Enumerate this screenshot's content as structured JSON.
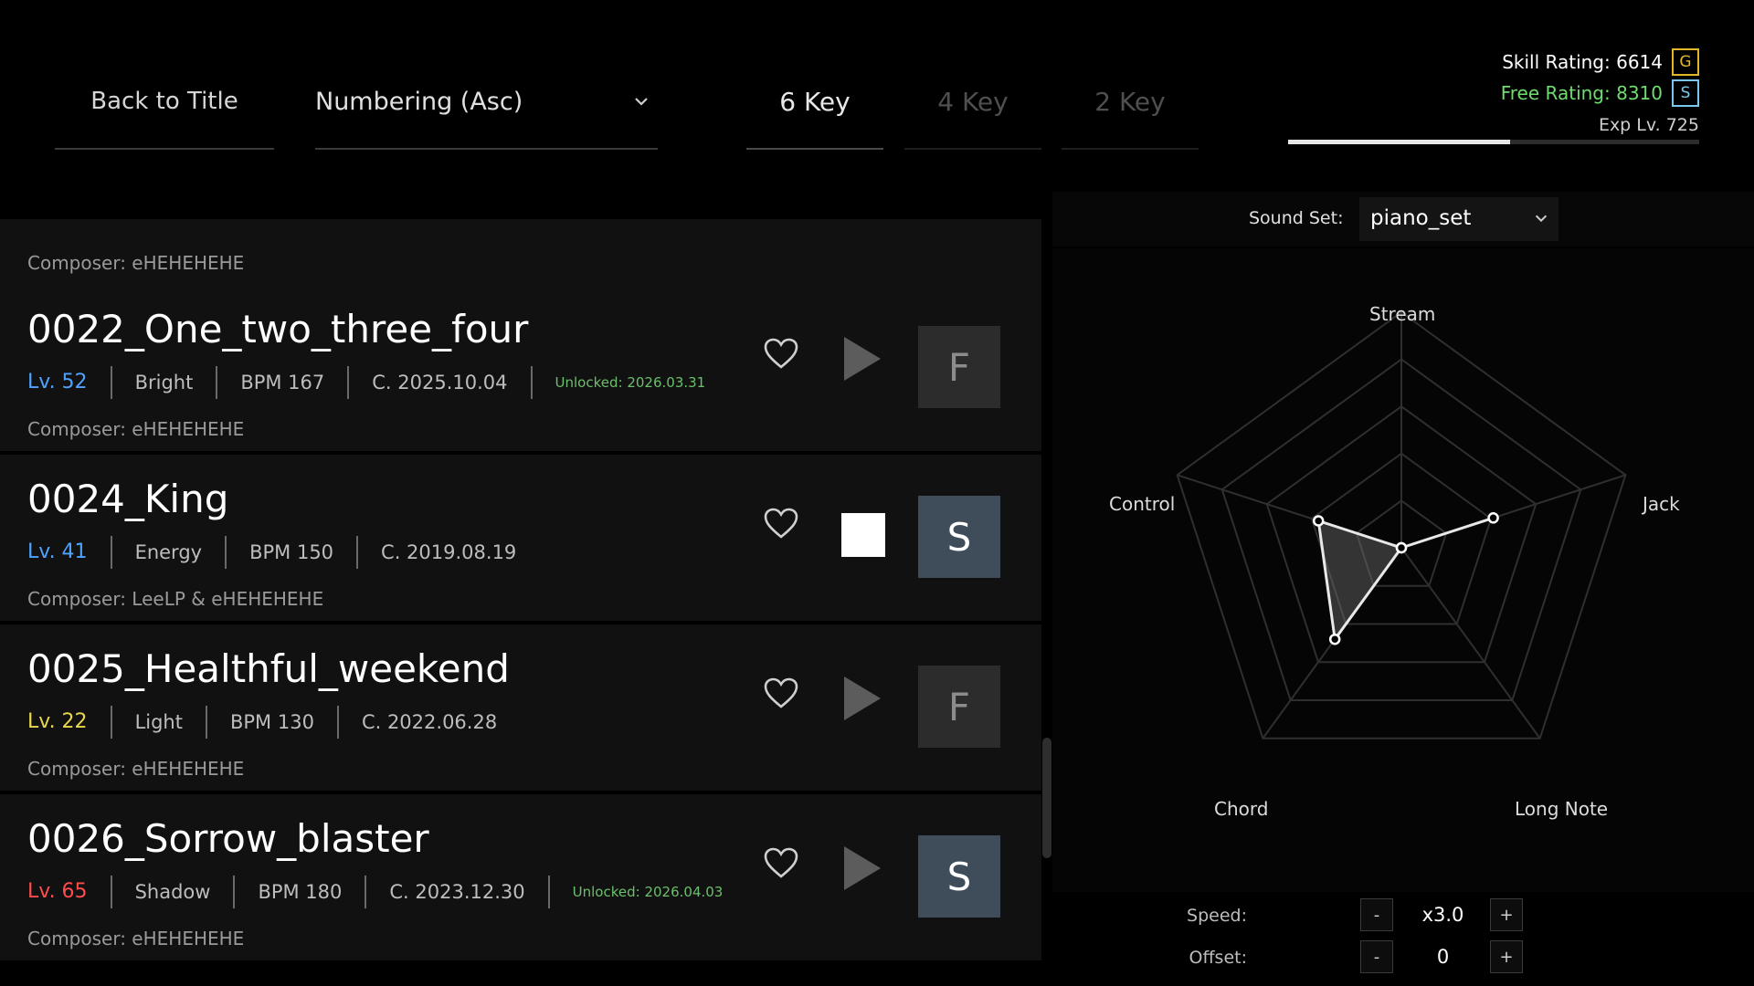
{
  "header": {
    "back_label": "Back to Title",
    "sort": {
      "selected": "Numbering (Asc)"
    },
    "key_tabs": [
      {
        "label": "6 Key",
        "active": true
      },
      {
        "label": "4 Key",
        "active": false
      },
      {
        "label": "2 Key",
        "active": false
      }
    ],
    "ratings": {
      "skill_text": "Skill Rating: 6614",
      "skill_badge": "G",
      "free_text": "Free Rating: 8310",
      "free_badge": "S",
      "exp_text": "Exp Lv. 725",
      "exp_progress": 0.54
    }
  },
  "songs": [
    {
      "composer": "Composer: eHEHEHEHE"
    },
    {
      "title": "0022_One_two_three_four",
      "level": "Lv. 52",
      "level_color": "#4ea3ff",
      "mood": "Bright",
      "bpm": "BPM 167",
      "created": "C. 2025.10.04",
      "unlocked": "Unlocked: 2026.03.31",
      "composer": "Composer: eHEHEHEHE",
      "grade": "F",
      "playing": false
    },
    {
      "title": "0024_King",
      "level": "Lv. 41",
      "level_color": "#4ea3ff",
      "mood": "Energy",
      "bpm": "BPM 150",
      "created": "C. 2019.08.19",
      "composer": "Composer: LeeLP & eHEHEHEHE",
      "grade": "S",
      "playing": true
    },
    {
      "title": "0025_Healthful_weekend",
      "level": "Lv. 22",
      "level_color": "#e8d84a",
      "mood": "Light",
      "bpm": "BPM 130",
      "created": "C. 2022.06.28",
      "composer": "Composer: eHEHEHEHE",
      "grade": "F",
      "playing": false
    },
    {
      "title": "0026_Sorrow_blaster",
      "level": "Lv. 65",
      "level_color": "#ff4c4c",
      "mood": "Shadow",
      "bpm": "BPM 180",
      "created": "C. 2023.12.30",
      "unlocked": "Unlocked: 2026.04.03",
      "composer": "Composer: eHEHEHEHE",
      "grade": "S",
      "playing": false
    }
  ],
  "sound_set": {
    "label": "Sound Set:",
    "value": "piano_set"
  },
  "radar": {
    "axes": [
      "Stream",
      "Jack",
      "Long Note",
      "Chord",
      "Control"
    ],
    "values": [
      0,
      0.41,
      0,
      0.48,
      0.37
    ]
  },
  "controls": {
    "speed_label": "Speed:",
    "speed_value": "x3.0",
    "offset_label": "Offset:",
    "offset_value": "0",
    "minus": "-",
    "plus": "+"
  }
}
